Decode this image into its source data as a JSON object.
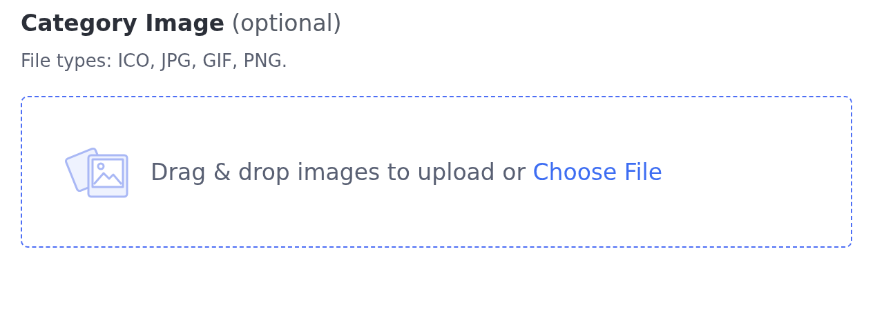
{
  "field": {
    "label": "Category Image",
    "optional_note": "(optional)",
    "help": "File types: ICO, JPG, GIF, PNG."
  },
  "dropzone": {
    "prompt": "Drag & drop images to upload or",
    "link": "Choose File"
  }
}
